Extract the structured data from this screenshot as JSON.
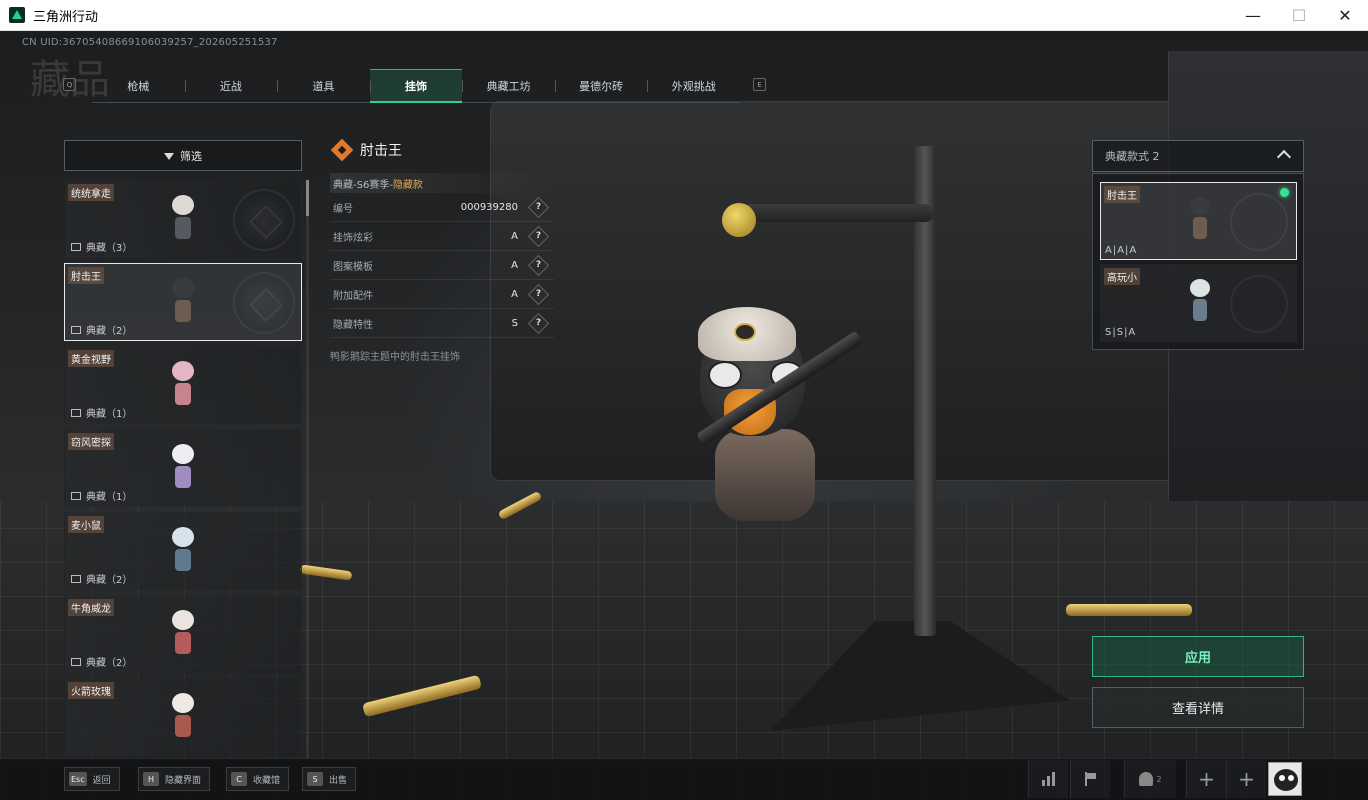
{
  "window": {
    "title": "三角洲行动",
    "minimize": "—",
    "maximize": "☐",
    "close": "✕"
  },
  "header": {
    "uid": "CN UID:3670540866910603925​7_202605251537",
    "bg_title": "藏品",
    "tab_left_key": "Q",
    "tab_right_key": "E",
    "tabs": [
      "枪械",
      "近战",
      "道具",
      "挂饰",
      "典藏工坊",
      "曼德尔砖",
      "外观挑战"
    ],
    "active_tab": "挂饰"
  },
  "filter": {
    "label": "筛选"
  },
  "items": [
    {
      "name": "统统拿走",
      "sub": "典藏（3）"
    },
    {
      "name": "肘击王",
      "sub": "典藏（2）"
    },
    {
      "name": "黄金视野",
      "sub": "典藏（1）"
    },
    {
      "name": "窃风密探",
      "sub": "典藏（1）"
    },
    {
      "name": "麦小鼠",
      "sub": "典藏（2）"
    },
    {
      "name": "牛角威龙",
      "sub": "典藏（2）"
    },
    {
      "name": "火箭玫瑰",
      "sub": ""
    }
  ],
  "detail": {
    "title": "肘击王",
    "tag_prefix": "典藏-S6赛季-",
    "tag_highlight": "隐藏款",
    "serial_label": "编号",
    "serial_value": "000939280",
    "attrs": [
      {
        "label": "挂饰炫彩",
        "value": "A"
      },
      {
        "label": "图案模板",
        "value": "A"
      },
      {
        "label": "附加配件",
        "value": "A"
      },
      {
        "label": "隐藏特性",
        "value": "S"
      }
    ],
    "help": "?",
    "description": "鸭影鹅踪主题中的肘击王挂饰"
  },
  "variants": {
    "header": "典藏款式 2",
    "list": [
      {
        "name": "肘击王",
        "grade": "A|A|A"
      },
      {
        "name": "高玩小",
        "grade": "S|S|A"
      }
    ]
  },
  "actions": {
    "apply": "应用",
    "detail": "查看详情"
  },
  "bottom": {
    "hints": [
      {
        "key": "Esc",
        "label": "返回"
      },
      {
        "key": "H",
        "label": "隐藏界面"
      },
      {
        "key": "C",
        "label": "收藏馆"
      },
      {
        "key": "S",
        "label": "出售"
      }
    ],
    "plus": "+",
    "friend_count": "2"
  }
}
